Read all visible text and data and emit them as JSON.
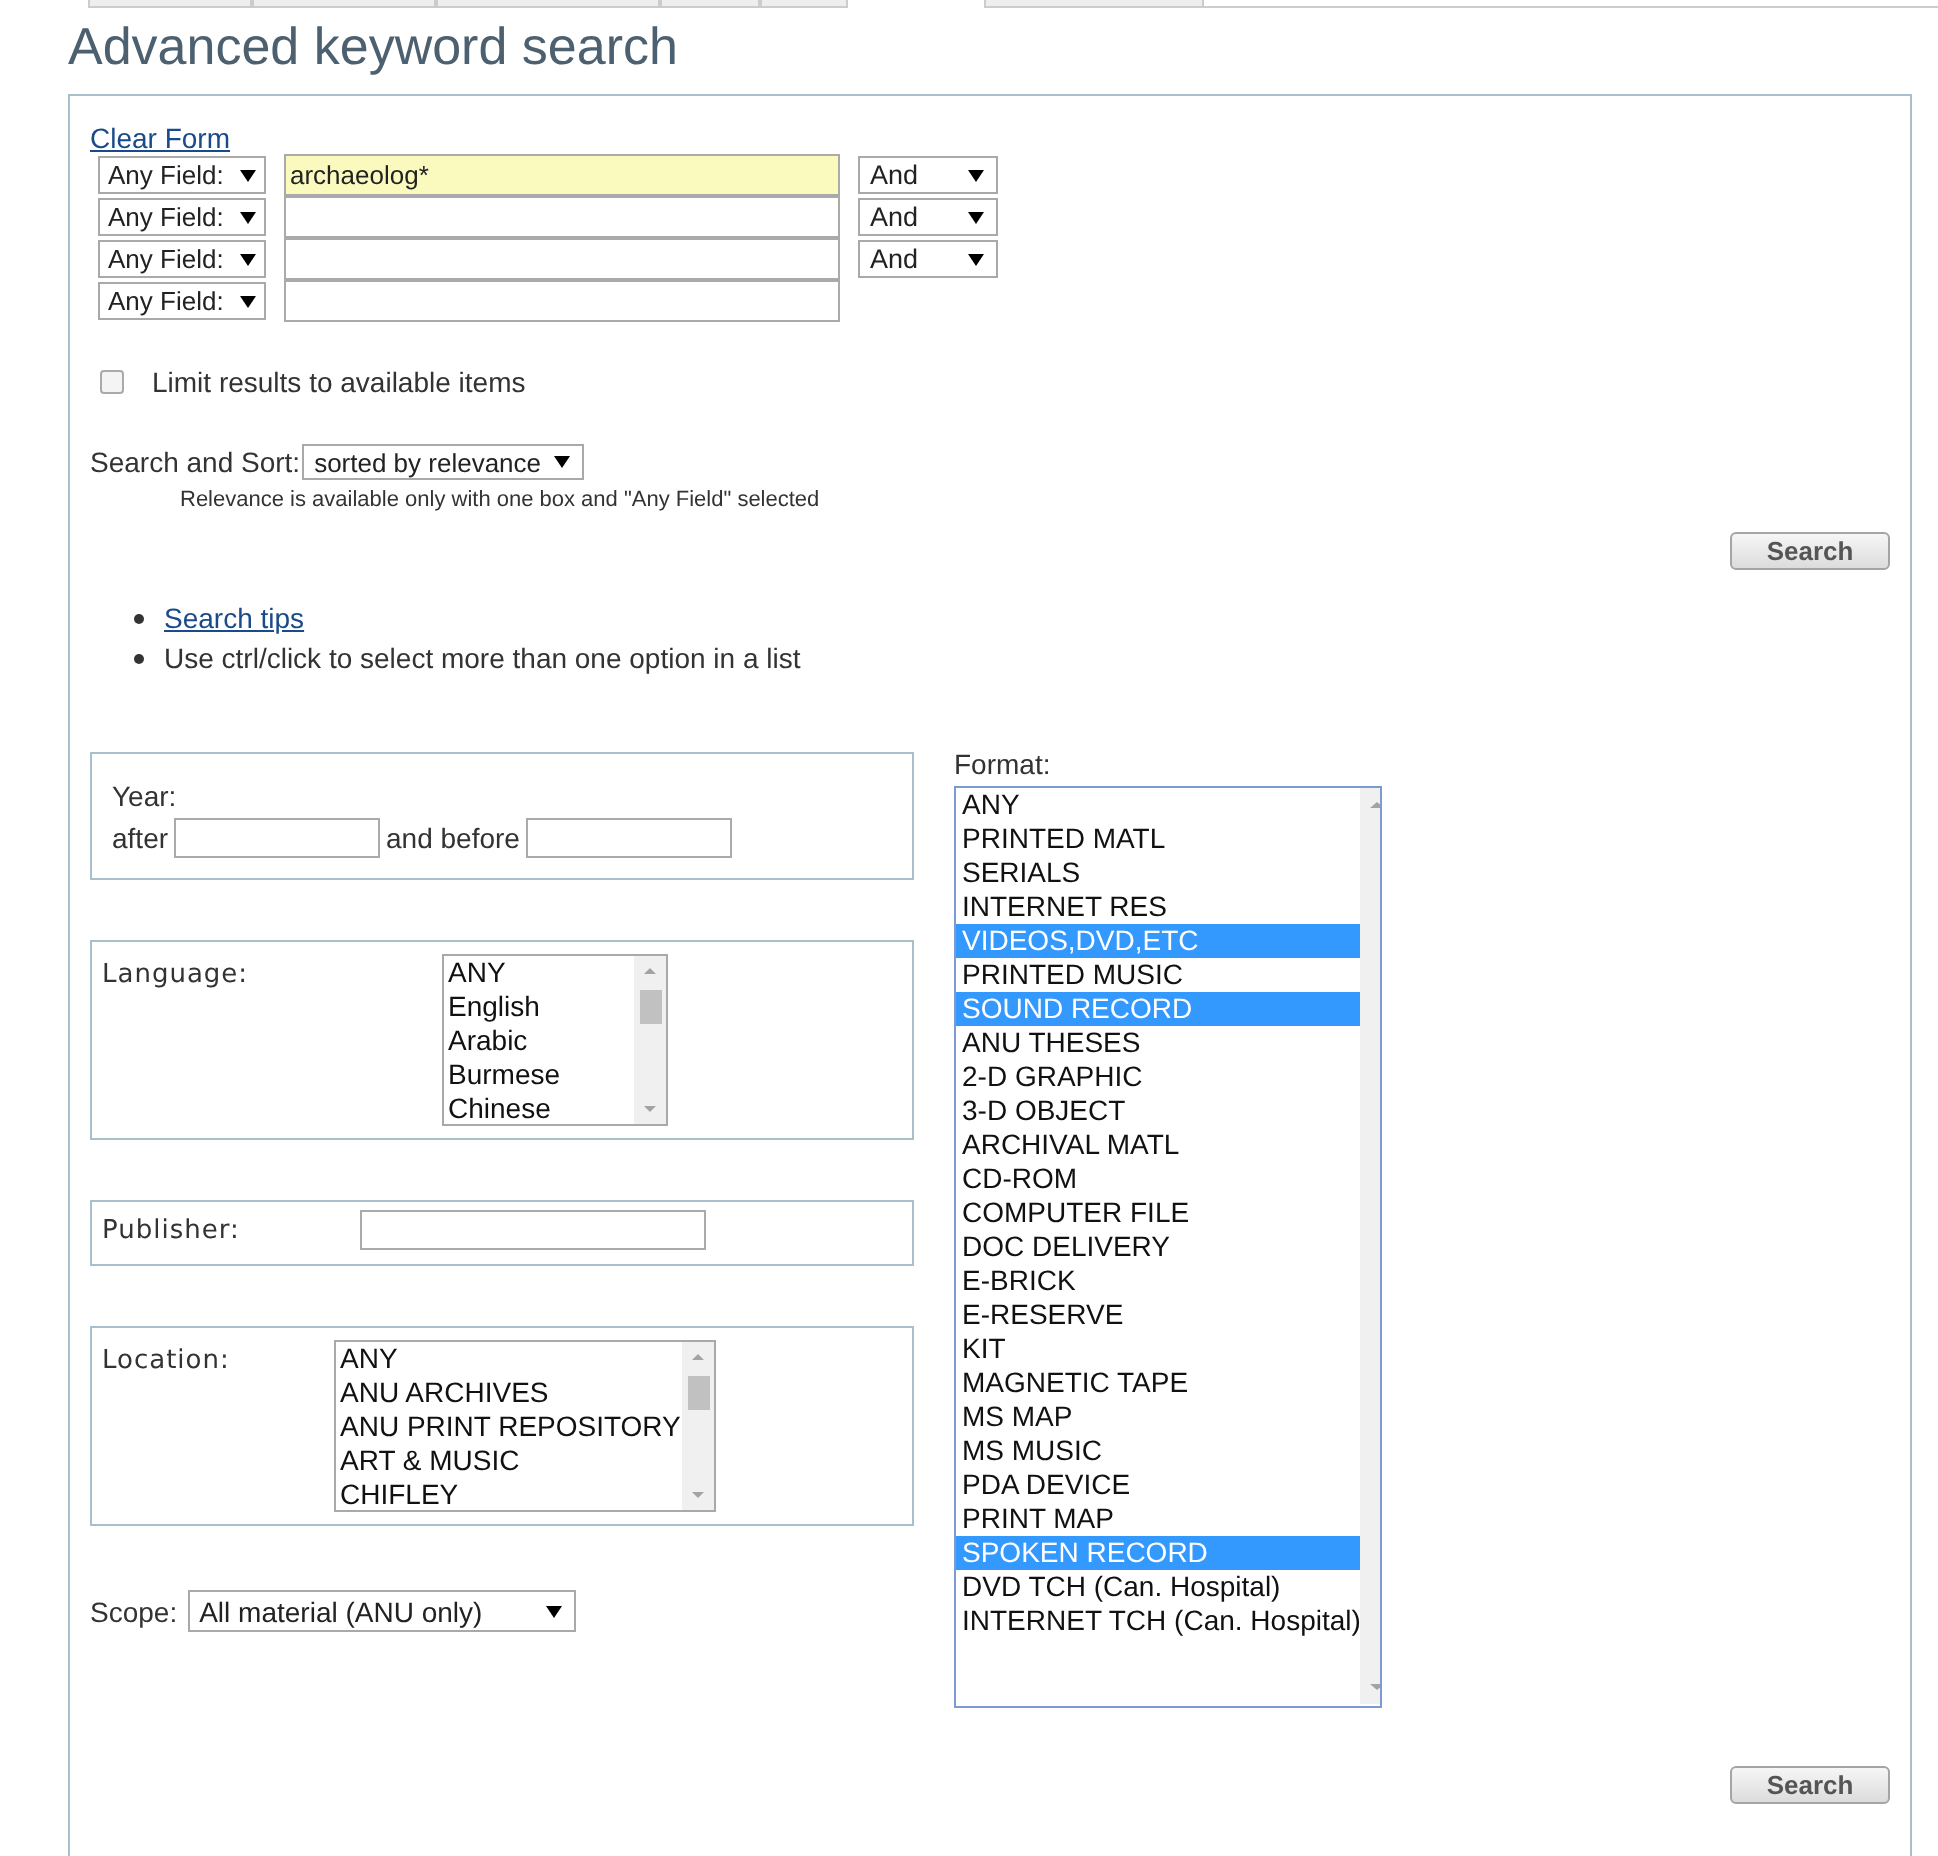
{
  "page_title": "Advanced keyword search",
  "clear_form": "Clear Form",
  "search_rows": [
    {
      "field": "Any Field:",
      "value": "archaeolog*",
      "autofilled": true,
      "operator": "And"
    },
    {
      "field": "Any Field:",
      "value": "",
      "autofilled": false,
      "operator": "And"
    },
    {
      "field": "Any Field:",
      "value": "",
      "autofilled": false,
      "operator": "And"
    },
    {
      "field": "Any Field:",
      "value": "",
      "autofilled": false
    }
  ],
  "limit_available": {
    "label": "Limit results to available items",
    "checked": false
  },
  "sort": {
    "label": "Search and Sort:",
    "value": "sorted by relevance",
    "note": "Relevance is available only with one box and \"Any Field\" selected"
  },
  "search_button": "Search",
  "tips": [
    {
      "kind": "link",
      "text": "Search tips"
    },
    {
      "kind": "text",
      "text": "Use ctrl/click to select more than one option in a list"
    }
  ],
  "year": {
    "label": "Year:",
    "after": "after",
    "before": "and before"
  },
  "language": {
    "label": "Language:",
    "options": [
      {
        "text": "ANY",
        "selected": false
      },
      {
        "text": "English",
        "selected": false
      },
      {
        "text": "Arabic",
        "selected": false
      },
      {
        "text": "Burmese",
        "selected": false
      },
      {
        "text": "Chinese",
        "selected": false
      }
    ]
  },
  "publisher": {
    "label": "Publisher:"
  },
  "location": {
    "label": "Location:",
    "options": [
      {
        "text": "ANY",
        "selected": false
      },
      {
        "text": "ANU ARCHIVES",
        "selected": false
      },
      {
        "text": "ANU PRINT REPOSITORY",
        "selected": false
      },
      {
        "text": "ART & MUSIC",
        "selected": false
      },
      {
        "text": "CHIFLEY",
        "selected": false
      }
    ]
  },
  "scope": {
    "label": "Scope:",
    "value": "All material (ANU only)"
  },
  "format": {
    "label": "Format:",
    "options": [
      {
        "text": "ANY",
        "selected": false
      },
      {
        "text": "PRINTED MATL",
        "selected": false
      },
      {
        "text": "SERIALS",
        "selected": false
      },
      {
        "text": "INTERNET RES",
        "selected": false
      },
      {
        "text": "VIDEOS,DVD,ETC",
        "selected": true
      },
      {
        "text": "PRINTED MUSIC",
        "selected": false
      },
      {
        "text": "SOUND RECORD",
        "selected": true
      },
      {
        "text": "ANU THESES",
        "selected": false
      },
      {
        "text": "2-D GRAPHIC",
        "selected": false
      },
      {
        "text": "3-D OBJECT",
        "selected": false
      },
      {
        "text": "ARCHIVAL MATL",
        "selected": false
      },
      {
        "text": "CD-ROM",
        "selected": false
      },
      {
        "text": "COMPUTER FILE",
        "selected": false
      },
      {
        "text": "DOC DELIVERY",
        "selected": false
      },
      {
        "text": "E-BRICK",
        "selected": false
      },
      {
        "text": "E-RESERVE",
        "selected": false
      },
      {
        "text": "KIT",
        "selected": false
      },
      {
        "text": "MAGNETIC TAPE",
        "selected": false
      },
      {
        "text": "MS MAP",
        "selected": false
      },
      {
        "text": "MS MUSIC",
        "selected": false
      },
      {
        "text": "PDA DEVICE",
        "selected": false
      },
      {
        "text": "PRINT MAP",
        "selected": false
      },
      {
        "text": "SPOKEN RECORD",
        "selected": true
      },
      {
        "text": "DVD TCH (Can. Hospital)",
        "selected": false
      },
      {
        "text": "INTERNET TCH (Can. Hospital)",
        "selected": false
      }
    ]
  },
  "bottom_search_button": "Search"
}
